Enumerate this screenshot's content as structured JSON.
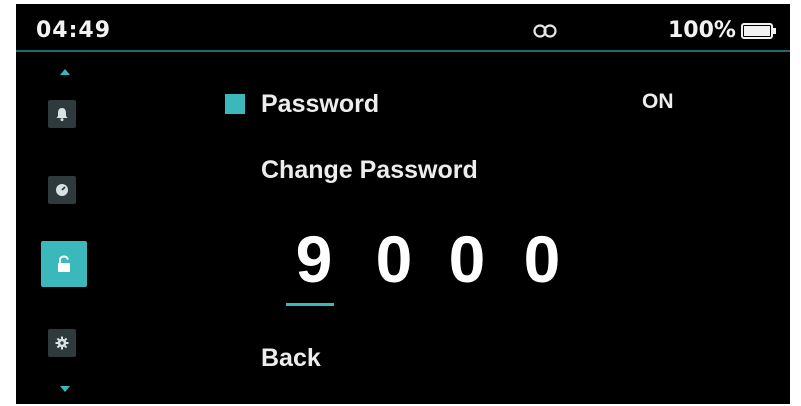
{
  "status_bar": {
    "time": "04:49",
    "link_icon": "link-icon",
    "battery_percent": "100%",
    "battery_icon": "battery-full-icon",
    "battery_level": 1.0
  },
  "side_nav": {
    "up_icon": "chevron-up-icon",
    "down_icon": "chevron-down-icon",
    "items": [
      {
        "icon": "bell-icon",
        "active": false
      },
      {
        "icon": "gauge-icon",
        "active": false
      },
      {
        "icon": "unlock-icon",
        "active": true
      },
      {
        "icon": "gear-icon",
        "active": false
      }
    ]
  },
  "menu": {
    "password_label": "Password",
    "password_value": "ON",
    "change_password_label": "Change Password",
    "digits": [
      "9",
      "0",
      "0",
      "0"
    ],
    "active_digit_index": 0,
    "back_label": "Back"
  },
  "colors": {
    "accent": "#3ab8bc",
    "background": "#000000",
    "text": "#ededed",
    "tile": "#2e3a3c"
  }
}
